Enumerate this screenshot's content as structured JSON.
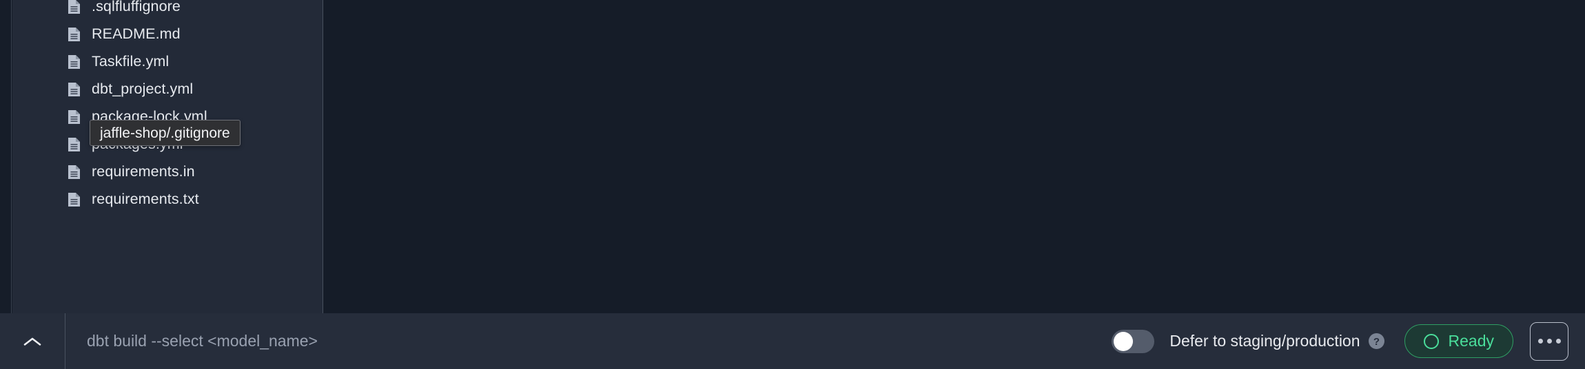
{
  "sidebar": {
    "files": [
      {
        "name": ".sqlfluffignore",
        "icon": "file-icon"
      },
      {
        "name": "README.md",
        "icon": "file-icon"
      },
      {
        "name": "Taskfile.yml",
        "icon": "file-icon"
      },
      {
        "name": "dbt_project.yml",
        "icon": "file-icon"
      },
      {
        "name": "package-lock.yml",
        "icon": "file-icon"
      },
      {
        "name": "packages.yml",
        "icon": "file-icon"
      },
      {
        "name": "requirements.in",
        "icon": "file-icon"
      },
      {
        "name": "requirements.txt",
        "icon": "file-icon"
      }
    ]
  },
  "tooltip": {
    "text": "jaffle-shop/.gitignore"
  },
  "bottom_bar": {
    "collapse_icon": "chevron-up-icon",
    "command": {
      "value": "",
      "placeholder": "dbt build --select <model_name>"
    },
    "defer_toggle": {
      "label": "Defer to staging/production",
      "state": "off",
      "help_icon": "question-mark-circle-icon"
    },
    "status": {
      "label": "Ready",
      "icon": "circle-icon",
      "color": "#4ade9b",
      "background": "#1d3a34",
      "border": "#2f9e63"
    },
    "more": {
      "icon": "ellipsis-icon"
    }
  },
  "colors": {
    "sidebar_bg": "#232a38",
    "editor_bg": "#151c28",
    "bottom_bar_bg": "#262d3b",
    "text_primary": "#e6e9ee",
    "text_muted": "#99a1b0",
    "divider": "#49515f",
    "tooltip_bg": "#2f3033"
  }
}
